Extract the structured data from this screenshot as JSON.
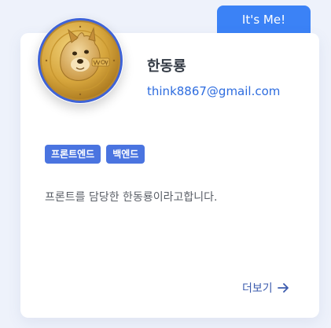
{
  "header": {
    "badge_label": "It's Me!"
  },
  "profile": {
    "avatar_icon": "doge-coin-avatar-icon",
    "name": "한동룡",
    "email": "think8867@gmail.com"
  },
  "tags": [
    {
      "label": "프론트엔드"
    },
    {
      "label": "백엔드"
    }
  ],
  "description": "프론트를 담당한 한동룡이라고합니다.",
  "actions": {
    "more_label": "더보기"
  },
  "colors": {
    "background": "#eef2fb",
    "accent": "#3b82f6",
    "tag": "#4a74e0",
    "email": "#2d6cdf",
    "link": "#3d5cae"
  }
}
